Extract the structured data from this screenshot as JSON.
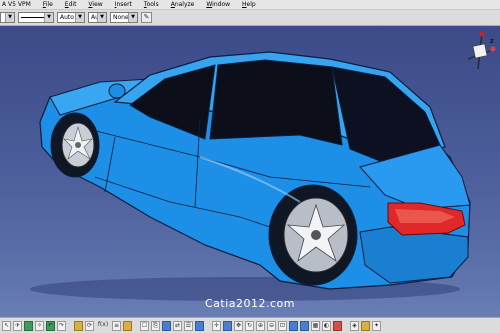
{
  "window": {
    "title": "A V5 VPM"
  },
  "menu": {
    "items": [
      {
        "label": "File",
        "key": "F",
        "rest": "ile"
      },
      {
        "label": "Edit",
        "key": "E",
        "rest": "dit"
      },
      {
        "label": "View",
        "key": "V",
        "rest": "iew"
      },
      {
        "label": "Insert",
        "key": "I",
        "rest": "nsert"
      },
      {
        "label": "Tools",
        "key": "T",
        "rest": "ools"
      },
      {
        "label": "Analyze",
        "key": "A",
        "rest": "nalyze"
      },
      {
        "label": "Window",
        "key": "W",
        "rest": "indow"
      },
      {
        "label": "Help",
        "key": "H",
        "rest": "elp"
      }
    ]
  },
  "toolbar": {
    "line_weight": "Auto",
    "line_type": "Aut",
    "layer": "None"
  },
  "viewport": {
    "watermark": "Catia2012.com",
    "compass_axis_label": "z",
    "car_color": "#1e8fe6",
    "tail_light_color": "#e0282a"
  },
  "bottom_toolbar": {
    "formula_label": "f(x)"
  }
}
